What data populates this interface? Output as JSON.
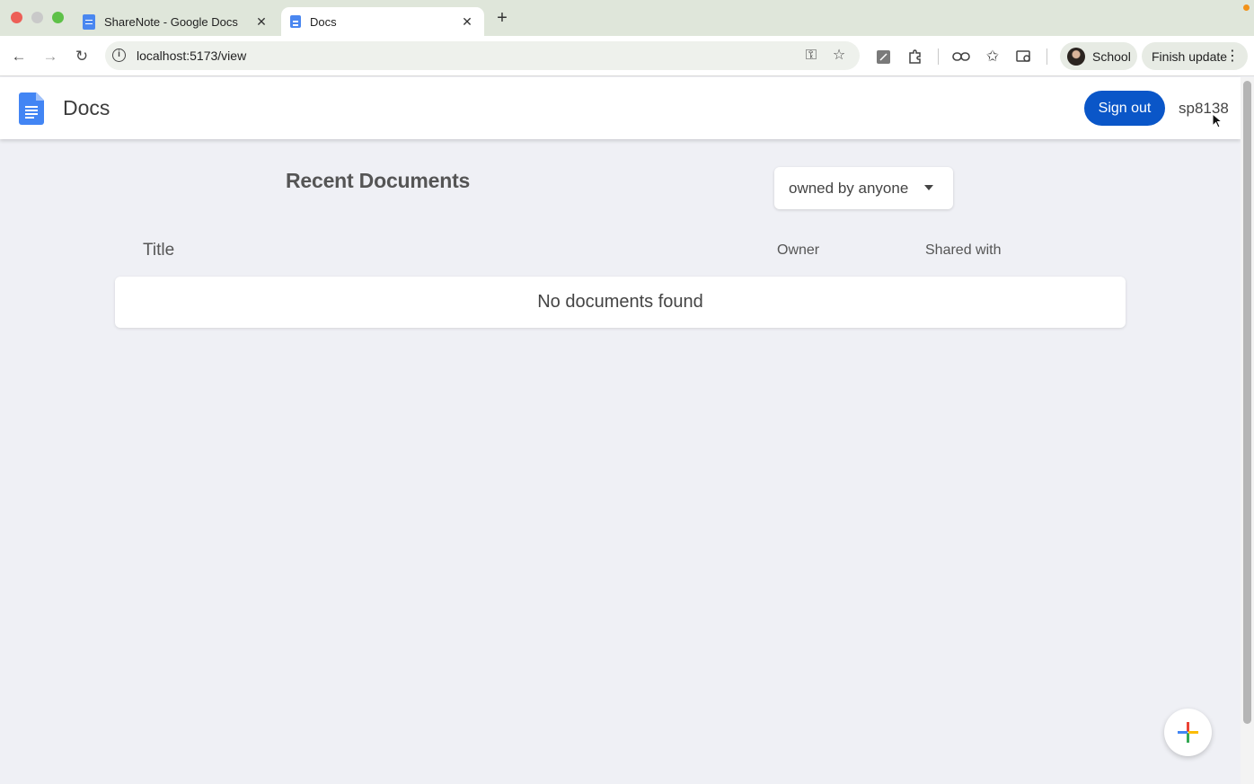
{
  "browser": {
    "tabs": [
      {
        "title": "ShareNote - Google Docs",
        "active": false
      },
      {
        "title": "Docs",
        "active": true
      }
    ],
    "url": "localhost:5173/view",
    "profile_label": "School",
    "update_label": "Finish update"
  },
  "header": {
    "brand": "Docs",
    "signout_label": "Sign out",
    "username": "sp8138"
  },
  "main": {
    "title": "Recent Documents",
    "filter": {
      "selected": "owned by anyone"
    },
    "columns": {
      "title": "Title",
      "owner": "Owner",
      "shared": "Shared with"
    },
    "empty_message": "No documents found"
  },
  "colors": {
    "primary": "#0a56c8",
    "background": "#eff0f5",
    "logo": "#4285f4"
  },
  "icons": {
    "back": "arrow-left-icon",
    "forward": "arrow-right-icon",
    "reload": "reload-icon",
    "create": "plus-icon"
  }
}
